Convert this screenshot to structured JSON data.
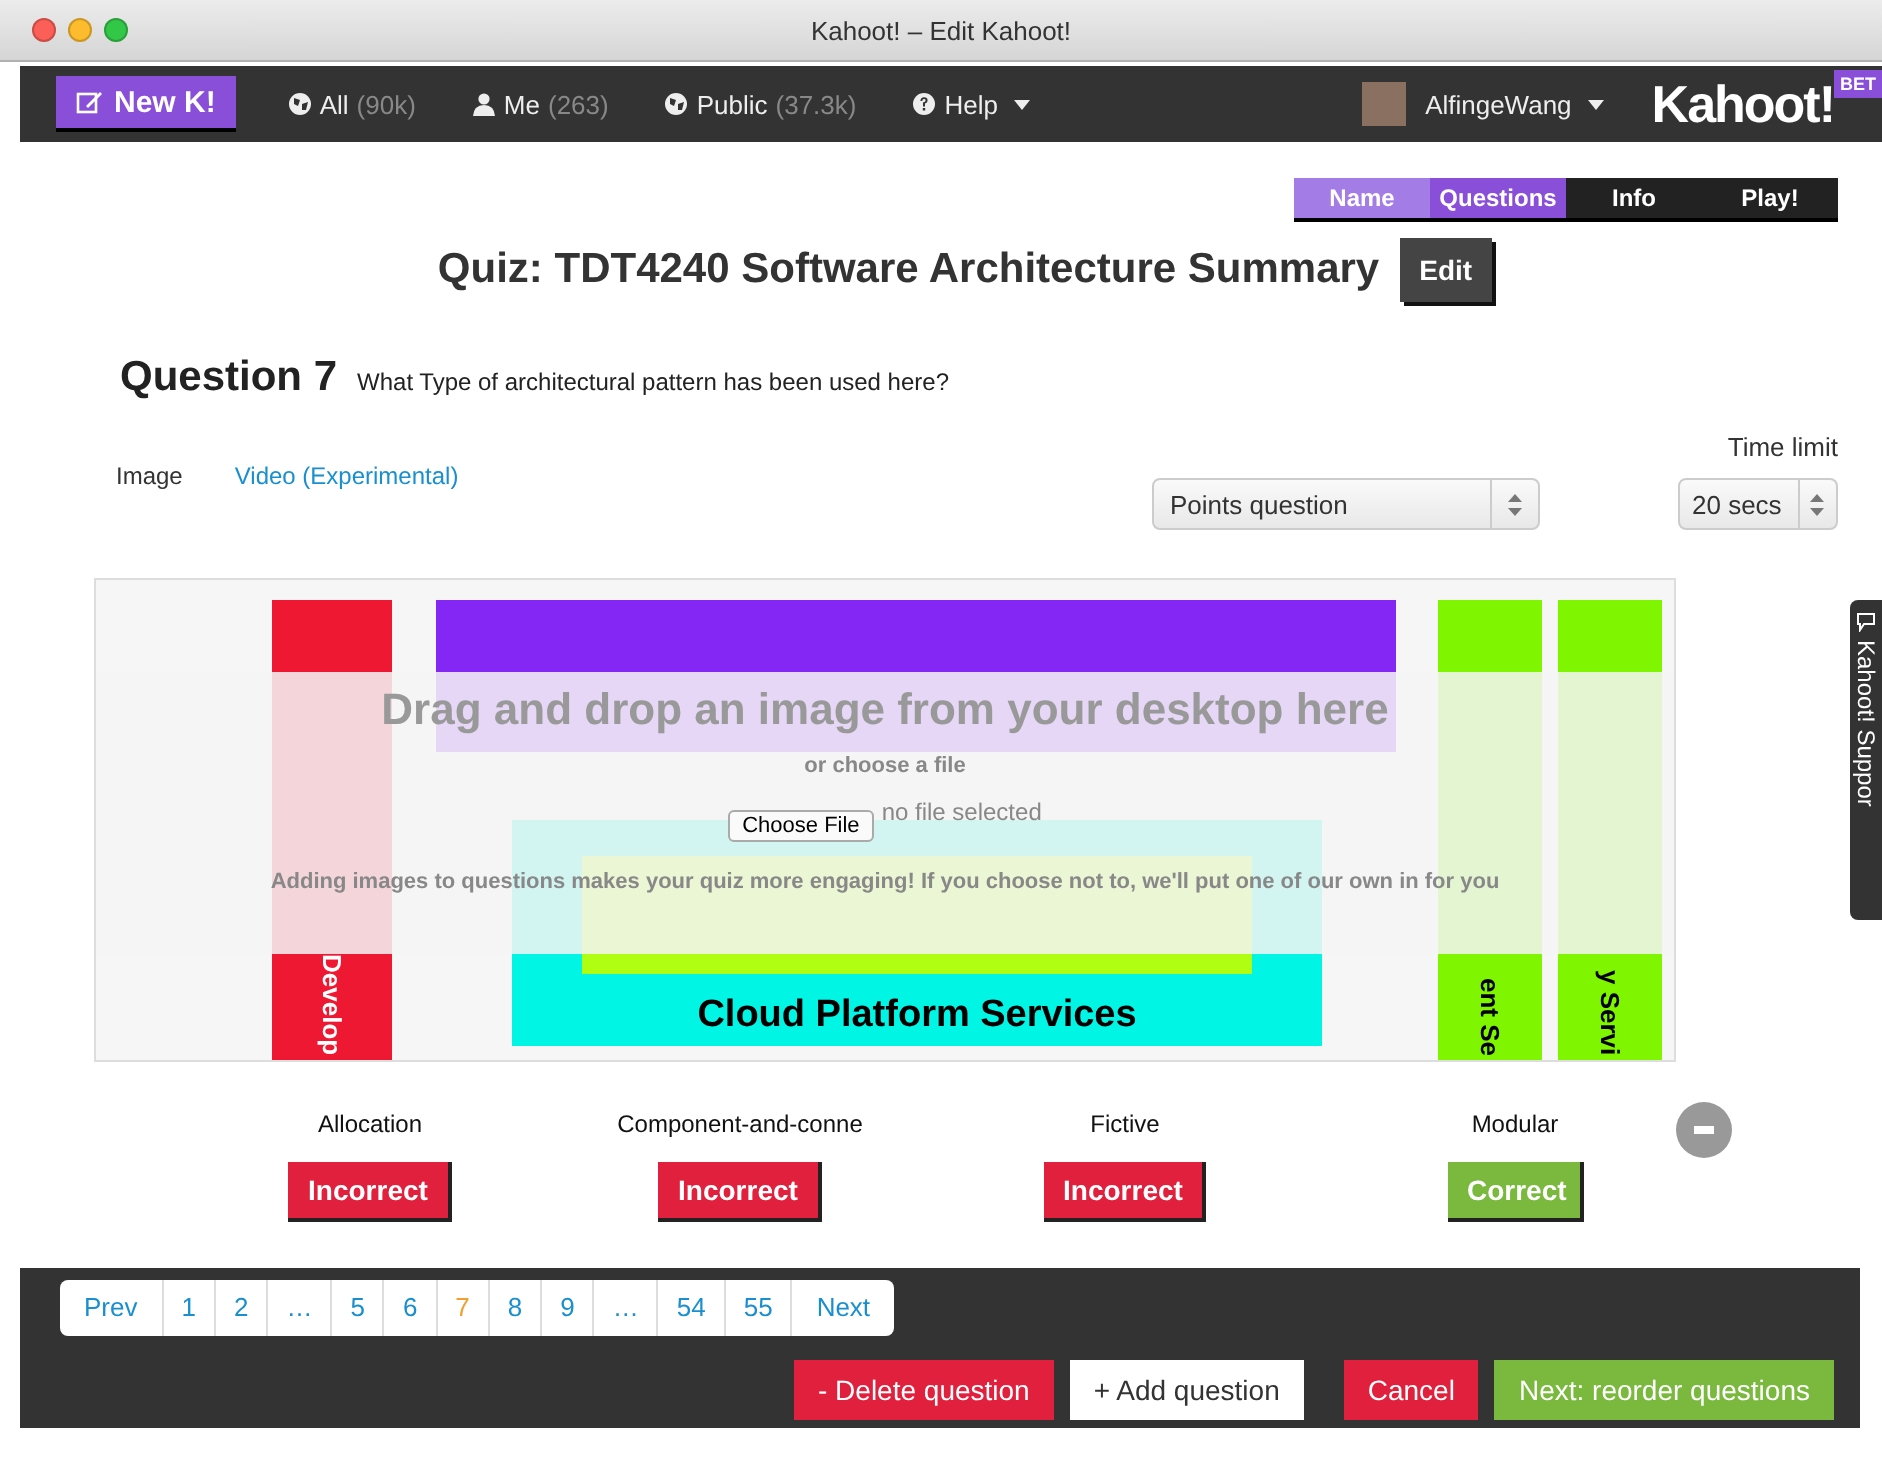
{
  "window": {
    "title": "Kahoot! – Edit Kahoot!"
  },
  "navbar": {
    "new_button": "New K!",
    "links": [
      {
        "kind": "globe",
        "label": "All",
        "count": "(90k)"
      },
      {
        "kind": "person",
        "label": "Me",
        "count": "(263)"
      },
      {
        "kind": "globe",
        "label": "Public",
        "count": "(37.3k)"
      }
    ],
    "help": "Help",
    "user": "AlfingeWang",
    "logo": "Kahoot!",
    "badge": "BET"
  },
  "steps": [
    {
      "label": "Name",
      "selected": false,
      "completed": true
    },
    {
      "label": "Questions",
      "selected": true,
      "completed": false
    },
    {
      "label": "Info",
      "selected": false,
      "completed": false
    },
    {
      "label": "Play!",
      "selected": false,
      "completed": false
    }
  ],
  "quiz_title": "Quiz: TDT4240 Software Architecture Summary",
  "edit_button": "Edit",
  "question": {
    "number_label": "Question 7",
    "text": "What Type of architectural pattern has been used here?"
  },
  "media_tabs": [
    {
      "label": "Image",
      "selected": true
    },
    {
      "label": "Video (Experimental)",
      "selected": false
    }
  ],
  "question_type": {
    "value": "Points question"
  },
  "time_limit": {
    "label": "Time limit",
    "value": "20 secs"
  },
  "diagram": {
    "left_column": "Develop",
    "outer_box": "Cloud Platform Services",
    "right_column_1": "ent Se",
    "right_column_2": "y Servi"
  },
  "image_drop": {
    "heading": "Drag and drop an image from your desktop here",
    "subheading": "or choose a file",
    "file_button": "Choose File",
    "file_status": "no file selected",
    "hint": "Adding images to questions makes your quiz more engaging! If you choose not to, we'll put one of our own in for you"
  },
  "answers": [
    {
      "text": "Allocation",
      "correct": false,
      "status": "Incorrect"
    },
    {
      "text": "Component-and-conne",
      "correct": false,
      "status": "Incorrect"
    },
    {
      "text": "Fictive",
      "correct": false,
      "status": "Incorrect"
    },
    {
      "text": "Modular",
      "correct": true,
      "status": "Correct"
    }
  ],
  "pagination": [
    {
      "label": "Prev",
      "selected": false
    },
    {
      "label": "1",
      "selected": false
    },
    {
      "label": "2",
      "selected": false
    },
    {
      "label": "…",
      "selected": false
    },
    {
      "label": "5",
      "selected": false
    },
    {
      "label": "6",
      "selected": false
    },
    {
      "label": "7",
      "selected": true
    },
    {
      "label": "8",
      "selected": false
    },
    {
      "label": "9",
      "selected": false
    },
    {
      "label": "…",
      "selected": false
    },
    {
      "label": "54",
      "selected": false
    },
    {
      "label": "55",
      "selected": false
    },
    {
      "label": "Next",
      "selected": false
    }
  ],
  "actions": [
    {
      "label": "- Delete question",
      "kind": "danger"
    },
    {
      "label": "+ Add question",
      "kind": "plain"
    },
    {
      "label": "Cancel",
      "kind": "danger"
    },
    {
      "label": "Next: reorder questions",
      "kind": "primary"
    }
  ],
  "support_tab": "Kahoot! Suppor"
}
